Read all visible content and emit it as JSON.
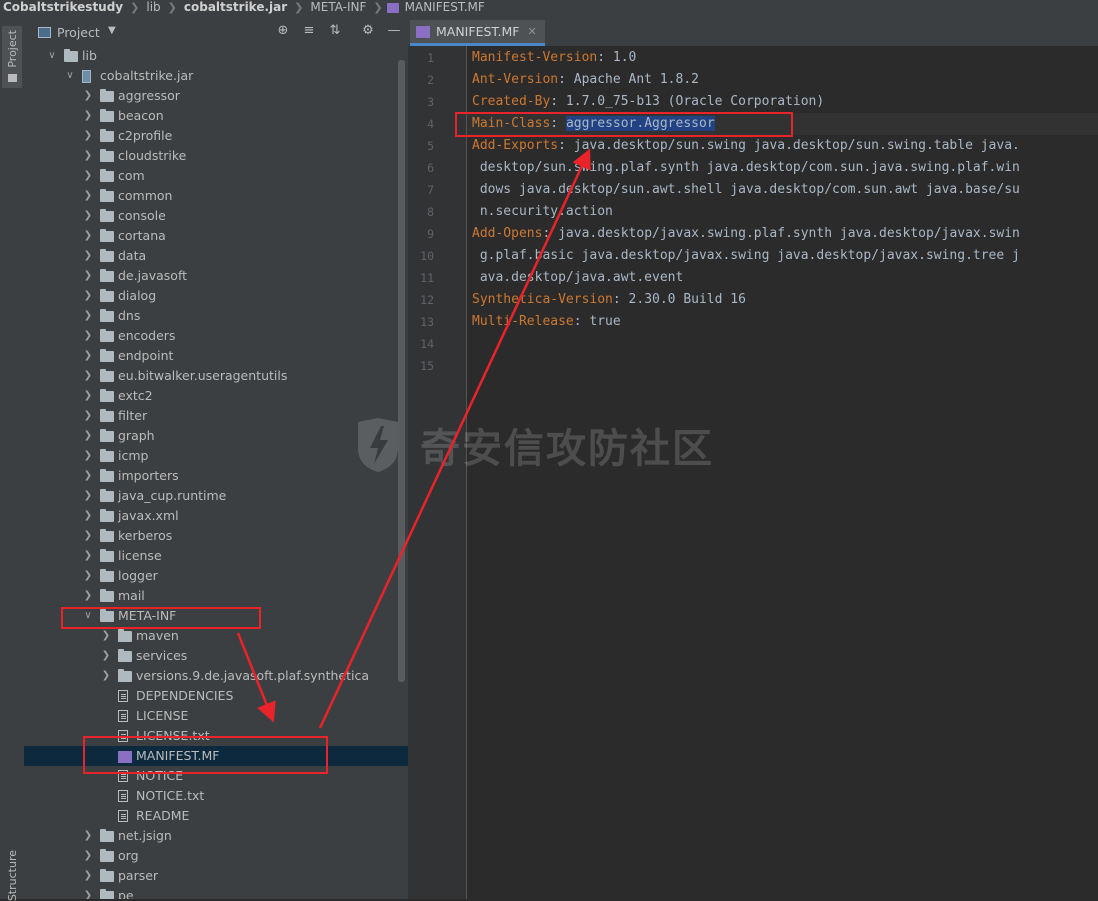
{
  "breadcrumb": {
    "items": [
      "Cobaltstrikestudy",
      "lib",
      "cobaltstrike.jar",
      "META-INF",
      "MANIFEST.MF"
    ]
  },
  "left_strip": {
    "project_tab": "Project",
    "structure_tab": "Structure"
  },
  "project_panel": {
    "title": "Project",
    "toolbar_icons": [
      "locate-icon",
      "expand-all-icon",
      "collapse-all-icon",
      "gear-icon",
      "minimize-icon"
    ],
    "tree": [
      {
        "label": "lib",
        "depth": 0,
        "type": "folder",
        "expanded": true
      },
      {
        "label": "cobaltstrike.jar",
        "depth": 1,
        "type": "jar",
        "expanded": true
      },
      {
        "label": "aggressor",
        "depth": 2,
        "type": "folder",
        "expanded": false
      },
      {
        "label": "beacon",
        "depth": 2,
        "type": "folder",
        "expanded": false
      },
      {
        "label": "c2profile",
        "depth": 2,
        "type": "folder",
        "expanded": false
      },
      {
        "label": "cloudstrike",
        "depth": 2,
        "type": "folder",
        "expanded": false
      },
      {
        "label": "com",
        "depth": 2,
        "type": "folder",
        "expanded": false
      },
      {
        "label": "common",
        "depth": 2,
        "type": "folder",
        "expanded": false
      },
      {
        "label": "console",
        "depth": 2,
        "type": "folder",
        "expanded": false
      },
      {
        "label": "cortana",
        "depth": 2,
        "type": "folder",
        "expanded": false
      },
      {
        "label": "data",
        "depth": 2,
        "type": "folder",
        "expanded": false
      },
      {
        "label": "de.javasoft",
        "depth": 2,
        "type": "folder",
        "expanded": false
      },
      {
        "label": "dialog",
        "depth": 2,
        "type": "folder",
        "expanded": false
      },
      {
        "label": "dns",
        "depth": 2,
        "type": "folder",
        "expanded": false
      },
      {
        "label": "encoders",
        "depth": 2,
        "type": "folder",
        "expanded": false
      },
      {
        "label": "endpoint",
        "depth": 2,
        "type": "folder",
        "expanded": false
      },
      {
        "label": "eu.bitwalker.useragentutils",
        "depth": 2,
        "type": "folder",
        "expanded": false
      },
      {
        "label": "extc2",
        "depth": 2,
        "type": "folder",
        "expanded": false
      },
      {
        "label": "filter",
        "depth": 2,
        "type": "folder",
        "expanded": false
      },
      {
        "label": "graph",
        "depth": 2,
        "type": "folder",
        "expanded": false
      },
      {
        "label": "icmp",
        "depth": 2,
        "type": "folder",
        "expanded": false
      },
      {
        "label": "importers",
        "depth": 2,
        "type": "folder",
        "expanded": false
      },
      {
        "label": "java_cup.runtime",
        "depth": 2,
        "type": "folder",
        "expanded": false
      },
      {
        "label": "javax.xml",
        "depth": 2,
        "type": "folder",
        "expanded": false
      },
      {
        "label": "kerberos",
        "depth": 2,
        "type": "folder",
        "expanded": false
      },
      {
        "label": "license",
        "depth": 2,
        "type": "folder",
        "expanded": false
      },
      {
        "label": "logger",
        "depth": 2,
        "type": "folder",
        "expanded": false
      },
      {
        "label": "mail",
        "depth": 2,
        "type": "folder",
        "expanded": false
      },
      {
        "label": "META-INF",
        "depth": 2,
        "type": "folder",
        "expanded": true
      },
      {
        "label": "maven",
        "depth": 3,
        "type": "folder",
        "expanded": false
      },
      {
        "label": "services",
        "depth": 3,
        "type": "folder",
        "expanded": false
      },
      {
        "label": "versions.9.de.javasoft.plaf.synthetica",
        "depth": 3,
        "type": "folder",
        "expanded": false
      },
      {
        "label": "DEPENDENCIES",
        "depth": 3,
        "type": "file"
      },
      {
        "label": "LICENSE",
        "depth": 3,
        "type": "file"
      },
      {
        "label": "LICENSE.txt",
        "depth": 3,
        "type": "file"
      },
      {
        "label": "MANIFEST.MF",
        "depth": 3,
        "type": "mf",
        "selected": true
      },
      {
        "label": "NOTICE",
        "depth": 3,
        "type": "file"
      },
      {
        "label": "NOTICE.txt",
        "depth": 3,
        "type": "file"
      },
      {
        "label": "README",
        "depth": 3,
        "type": "file"
      },
      {
        "label": "net.jsign",
        "depth": 2,
        "type": "folder",
        "expanded": false
      },
      {
        "label": "org",
        "depth": 2,
        "type": "folder",
        "expanded": false
      },
      {
        "label": "parser",
        "depth": 2,
        "type": "folder",
        "expanded": false
      },
      {
        "label": "pe",
        "depth": 2,
        "type": "folder",
        "expanded": false
      }
    ]
  },
  "editor": {
    "tab_title": "MANIFEST.MF",
    "line_numbers": [
      "1",
      "2",
      "3",
      "4",
      "5",
      "6",
      "7",
      "8",
      "9",
      "10",
      "11",
      "12",
      "13",
      "14",
      "15"
    ],
    "lines": [
      [
        {
          "k": "Manifest-Version"
        },
        {
          "v": ": 1.0"
        }
      ],
      [
        {
          "k": "Ant-Version"
        },
        {
          "v": ": Apache Ant 1.8.2"
        }
      ],
      [
        {
          "k": "Created-By"
        },
        {
          "v": ": 1.7.0_75-b13 (Oracle Corporation)"
        }
      ],
      [
        {
          "k": "Main-Class"
        },
        {
          "v": ": "
        },
        {
          "h": "aggressor.Aggressor"
        }
      ],
      [
        {
          "k": "Add-Exports"
        },
        {
          "v": ": java.desktop/sun.swing java.desktop/sun.swing.table java."
        }
      ],
      [
        {
          "v": " desktop/sun.swing.plaf.synth java.desktop/com.sun.java.swing.plaf.win"
        }
      ],
      [
        {
          "v": " dows java.desktop/sun.awt.shell java.desktop/com.sun.awt java.base/su"
        }
      ],
      [
        {
          "v": " n.security.action"
        }
      ],
      [
        {
          "k": "Add-Opens"
        },
        {
          "v": ": java.desktop/javax.swing.plaf.synth java.desktop/javax.swin"
        }
      ],
      [
        {
          "v": " g.plaf.basic java.desktop/javax.swing java.desktop/javax.swing.tree j"
        }
      ],
      [
        {
          "v": " ava.desktop/java.awt.event"
        }
      ],
      [
        {
          "k": "Synthetica-Version"
        },
        {
          "v": ": 2.30.0 Build 16"
        }
      ],
      [
        {
          "k": "Multi-Release"
        },
        {
          "v": ": true"
        }
      ],
      [],
      []
    ]
  },
  "watermark": {
    "text": "奇安信攻防社区"
  },
  "colors": {
    "annotation": "#e8232a",
    "key": "#cc7832",
    "value": "#a9b7c6",
    "selection": "#214283"
  }
}
